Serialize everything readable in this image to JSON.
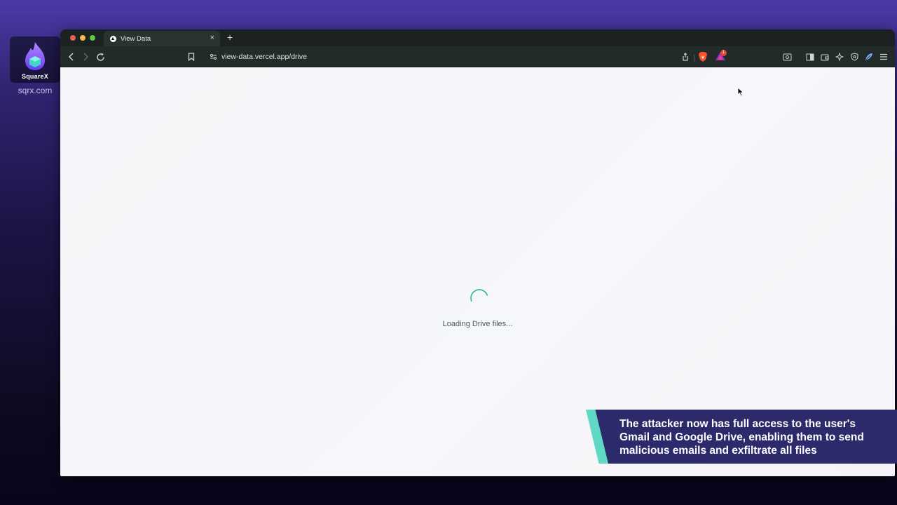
{
  "brand": {
    "name": "SquareX",
    "url": "sqrx.com"
  },
  "browser": {
    "tab": {
      "title": "View Data",
      "close_symbol": "×"
    },
    "new_tab_symbol": "+",
    "address_bar": {
      "url": "view-data.vercel.app/drive"
    },
    "extension_badge_count": "1",
    "icons": {
      "back": "chevron-left-icon",
      "forward": "chevron-right-icon",
      "reload": "reload-icon",
      "bookmark": "bookmark-icon",
      "site_settings": "site-settings-icon",
      "share": "share-icon",
      "brave_shields": "brave-lion-icon",
      "brave_rewards": "rewards-triangle-icon",
      "screenshot": "screenshot-icon",
      "sidebar": "sidebar-icon",
      "wallet": "wallet-icon",
      "leo_ai": "sparkle-icon",
      "vpn": "shield-icon",
      "extension": "feather-icon",
      "menu": "hamburger-menu-icon"
    }
  },
  "page": {
    "loading_text": "Loading Drive files..."
  },
  "caption": {
    "text": "The attacker now has full access to the user's Gmail and Google Drive, enabling them to send malicious emails and exfiltrate all files"
  },
  "colors": {
    "caption_background": "#2d2a6c",
    "caption_accent": "#5fd9c4",
    "spinner": "#2fb890",
    "page_background": "#f4f6f9"
  }
}
